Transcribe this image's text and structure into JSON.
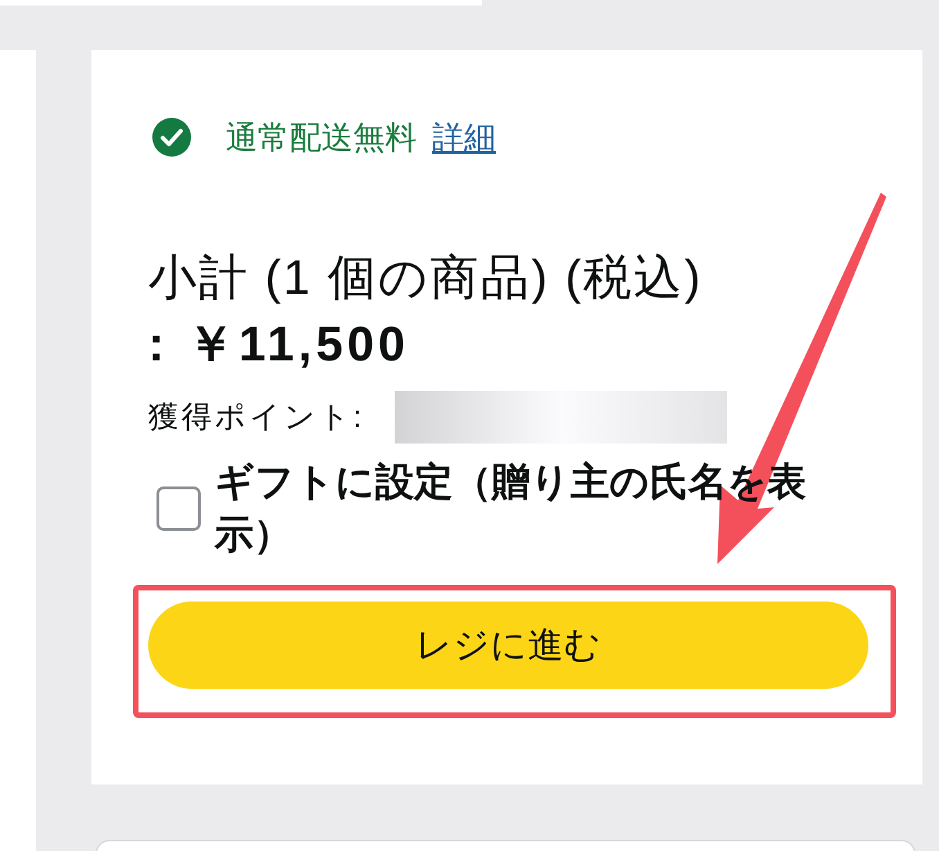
{
  "shipping": {
    "text": "通常配送無料",
    "link": "詳細"
  },
  "subtotal": {
    "label": "小計 (1 個の商品) (税込)",
    "amount": ": ￥11,500"
  },
  "points": {
    "label": "獲得ポイント:"
  },
  "gift": {
    "checked": false,
    "label": "ギフトに設定（贈り主の氏名を表示）"
  },
  "checkout_button": {
    "label": "レジに進む"
  }
}
